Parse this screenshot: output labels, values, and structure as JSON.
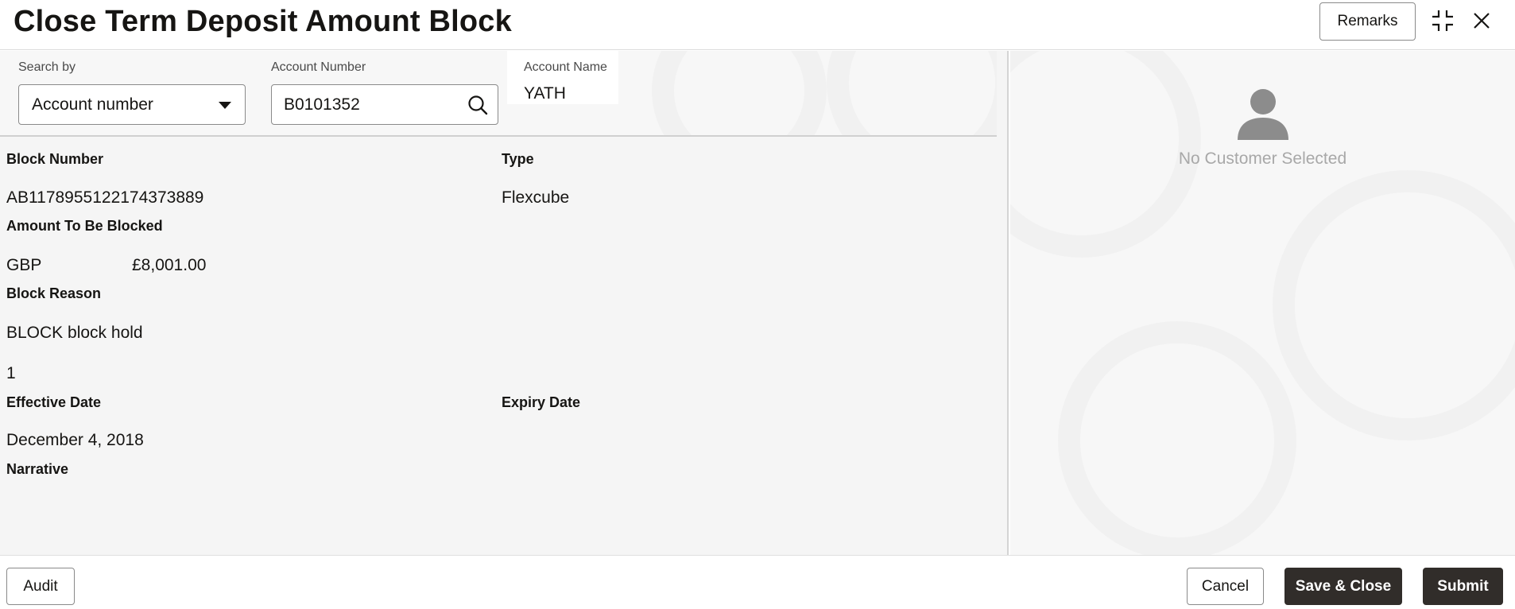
{
  "header": {
    "title": "Close Term Deposit Amount Block",
    "remarks_label": "Remarks"
  },
  "search": {
    "search_by_label": "Search by",
    "search_by_value": "Account number",
    "account_number_label": "Account Number",
    "account_number_value": "B0101352",
    "account_name_label": "Account Name",
    "account_name_value": "YATH"
  },
  "details": {
    "block_number_label": "Block Number",
    "block_number_value": "AB1178955122174373889",
    "type_label": "Type",
    "type_value": "Flexcube",
    "amount_label": "Amount To Be Blocked",
    "amount_currency": "GBP",
    "amount_value": "£8,001.00",
    "block_reason_label": "Block Reason",
    "block_reason_value": "BLOCK block hold",
    "block_reason_extra": "1",
    "effective_date_label": "Effective Date",
    "effective_date_value": "December 4, 2018",
    "expiry_date_label": "Expiry Date",
    "narrative_label": "Narrative"
  },
  "customer_panel": {
    "empty_text": "No Customer Selected"
  },
  "footer": {
    "audit_label": "Audit",
    "cancel_label": "Cancel",
    "save_close_label": "Save & Close",
    "submit_label": "Submit"
  },
  "colors": {
    "primary_button": "#312d2a",
    "panel_background": "#f5f5f5",
    "muted_text": "#a8a8a8"
  }
}
